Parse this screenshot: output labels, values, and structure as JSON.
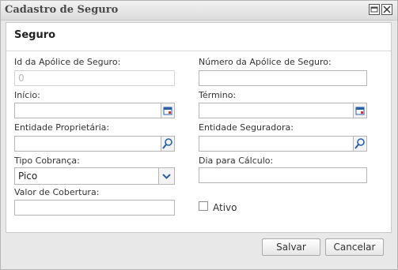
{
  "window": {
    "title": "Cadastro de Seguro"
  },
  "section": {
    "title": "Seguro"
  },
  "fields": {
    "policy_id": {
      "label": "Id da Apólice de Seguro:",
      "value": "0"
    },
    "policy_number": {
      "label": "Número da Apólice de Seguro:",
      "value": ""
    },
    "start": {
      "label": "Início:",
      "value": ""
    },
    "end": {
      "label": "Término:",
      "value": ""
    },
    "owner_entity": {
      "label": "Entidade Proprietária:",
      "value": ""
    },
    "insurer_entity": {
      "label": "Entidade Seguradora:",
      "value": ""
    },
    "billing_type": {
      "label": "Tipo Cobrança:",
      "value": "Pico"
    },
    "calc_day": {
      "label": "Dia para Cálculo:",
      "value": ""
    },
    "coverage_value": {
      "label": "Valor de Cobertura:",
      "value": ""
    },
    "active": {
      "label": "Ativo",
      "checked": false
    }
  },
  "buttons": {
    "save": "Salvar",
    "cancel": "Cancelar"
  },
  "colors": {
    "icon_blue": "#2a5fa8"
  }
}
